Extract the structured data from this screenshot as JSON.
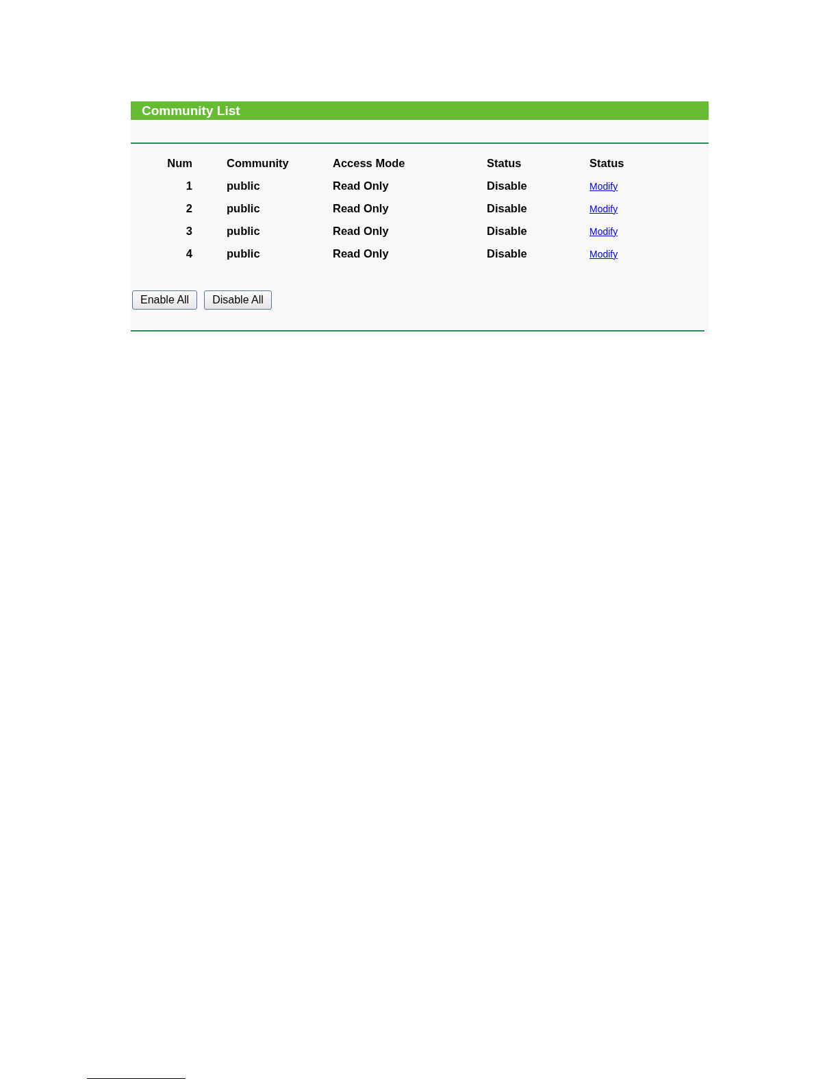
{
  "panel": {
    "title": "Community List"
  },
  "table": {
    "columns": [
      "Num",
      "Community",
      "Access Mode",
      "Status",
      "Status"
    ],
    "rows": [
      {
        "num": "1",
        "community": "public",
        "access_mode": "Read Only",
        "status": "Disable",
        "action": "Modify"
      },
      {
        "num": "2",
        "community": "public",
        "access_mode": "Read Only",
        "status": "Disable",
        "action": "Modify"
      },
      {
        "num": "3",
        "community": "public",
        "access_mode": "Read Only",
        "status": "Disable",
        "action": "Modify"
      },
      {
        "num": "4",
        "community": "public",
        "access_mode": "Read Only",
        "status": "Disable",
        "action": "Modify"
      }
    ]
  },
  "buttons": [
    "Enable All",
    "Disable All"
  ]
}
